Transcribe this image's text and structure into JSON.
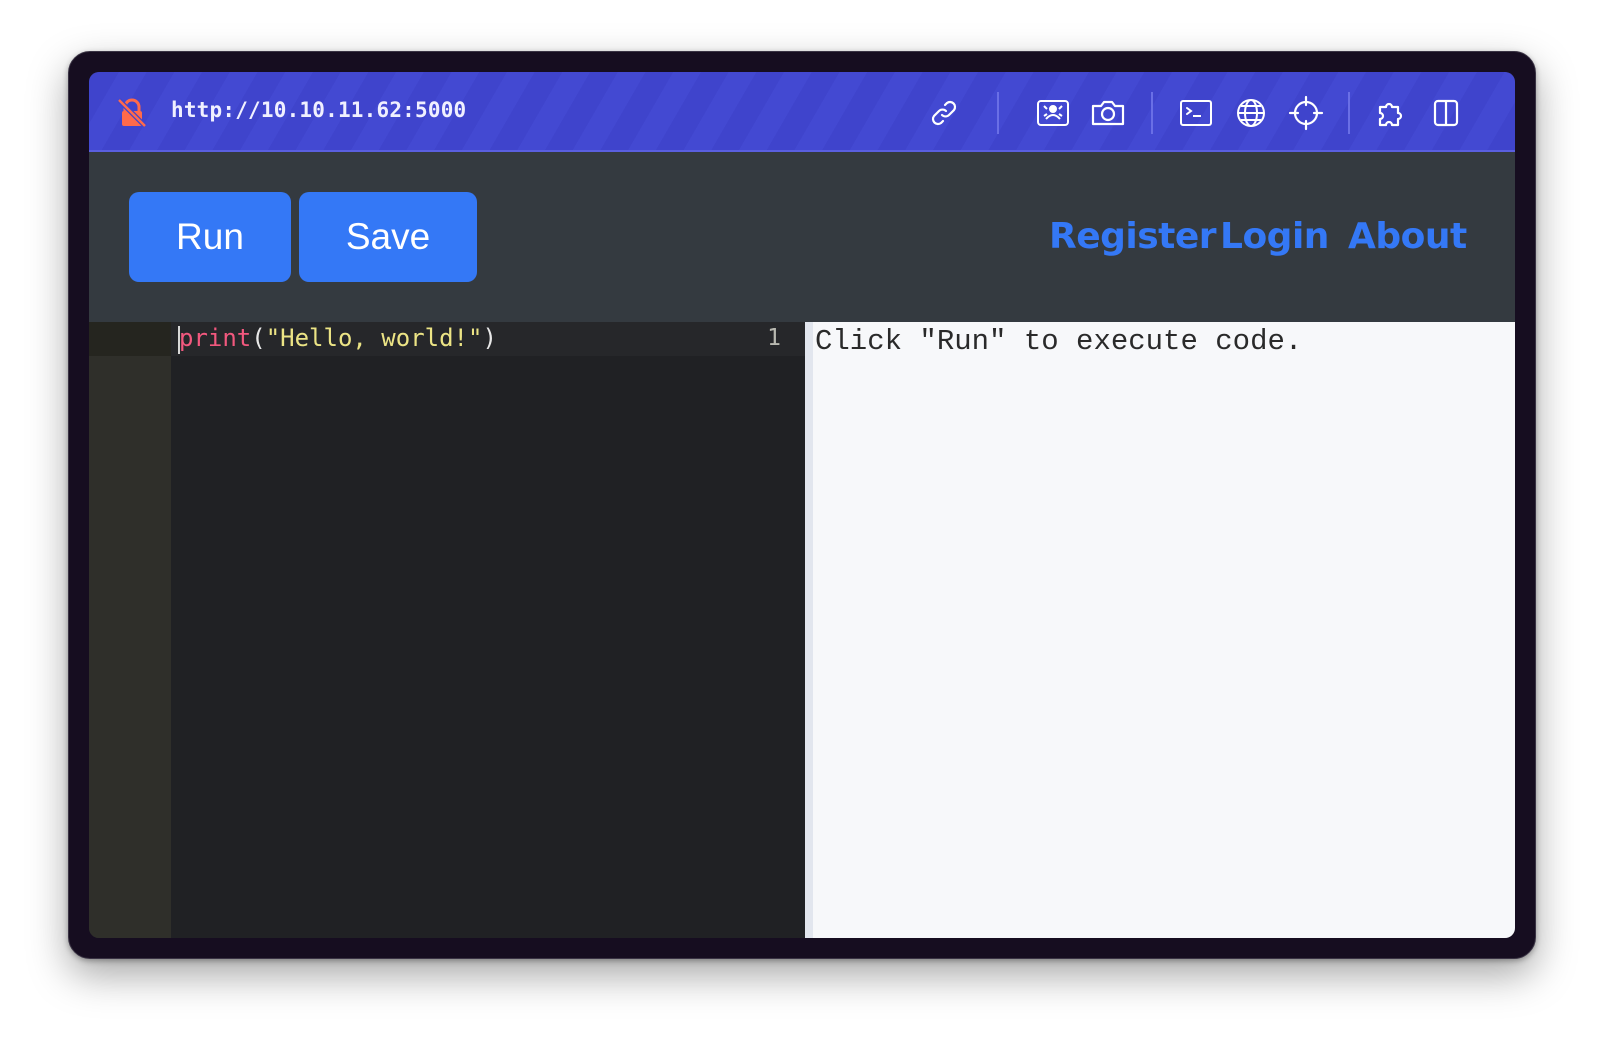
{
  "browser": {
    "url": "http://10.10.11.62:5000",
    "icons": [
      "lock-off-icon",
      "link-icon",
      "image-icon",
      "camera-icon",
      "terminal-icon",
      "globe-icon",
      "crosshair-icon",
      "puzzle-icon",
      "sidebar-icon"
    ]
  },
  "header": {
    "run_label": "Run",
    "save_label": "Save",
    "nav": {
      "register": "Register",
      "login": "Login",
      "about": "About"
    }
  },
  "editor": {
    "lines": [
      {
        "number": "1",
        "tokens": {
          "fn": "print",
          "open": "(",
          "str": "\"Hello, world!\"",
          "close": ")"
        }
      }
    ]
  },
  "output": {
    "text": "Click \"Run\" to execute code."
  },
  "colors": {
    "toolbar_bg": "#3f44cc",
    "header_bg": "#343a40",
    "accent": "#3478f6",
    "editor_bg": "#202124",
    "output_bg": "#f7f8fa"
  }
}
